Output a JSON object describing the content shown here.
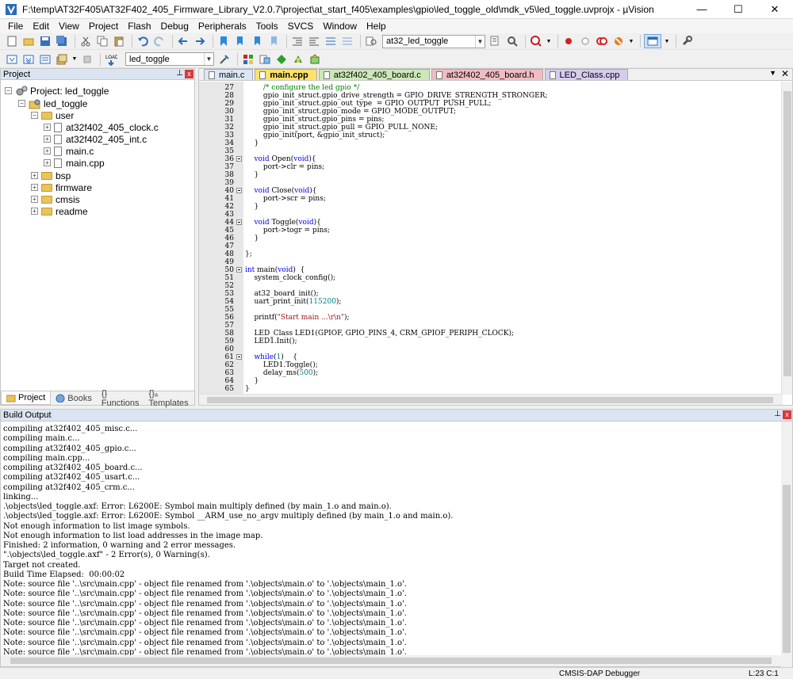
{
  "window": {
    "title": "F:\\temp\\AT32F405\\AT32F402_405_Firmware_Library_V2.0.7\\project\\at_start_f405\\examples\\gpio\\led_toggle_old\\mdk_v5\\led_toggle.uvprojx - µVision",
    "minimize": "—",
    "maximize": "☐",
    "close": "✕"
  },
  "menu": [
    "File",
    "Edit",
    "View",
    "Project",
    "Flash",
    "Debug",
    "Peripherals",
    "Tools",
    "SVCS",
    "Window",
    "Help"
  ],
  "toolbar1": {
    "target_combo": "at32_led_toggle"
  },
  "toolbar2": {
    "target_select": "led_toggle"
  },
  "project": {
    "header": "Project",
    "pin": "⊥",
    "close": "x",
    "root": "Project: led_toggle",
    "target": "led_toggle",
    "groups": {
      "user": "user",
      "bsp": "bsp",
      "firmware": "firmware",
      "cmsis": "cmsis",
      "readme": "readme"
    },
    "user_files": [
      "at32f402_405_clock.c",
      "at32f402_405_int.c",
      "main.c",
      "main.cpp"
    ],
    "tabs": [
      "Project",
      "Books",
      "{} Functions",
      "{}ₐ Templates"
    ]
  },
  "editor": {
    "tabs": [
      "main.c",
      "main.cpp",
      "at32f402_405_board.c",
      "at32f402_405_board.h",
      "LED_Class.cpp"
    ],
    "active_tab": "main.cpp",
    "tab_menu": "▼",
    "tab_close": "✕",
    "lines": [
      {
        "n": "27",
        "t": "        /* configure the led gpio */"
      },
      {
        "n": "28",
        "t": "        gpio_init_struct.gpio_drive_strength = GPIO_DRIVE_STRENGTH_STRONGER;"
      },
      {
        "n": "29",
        "t": "        gpio_init_struct.gpio_out_type  = GPIO_OUTPUT_PUSH_PULL;"
      },
      {
        "n": "30",
        "t": "        gpio_init_struct.gpio_mode = GPIO_MODE_OUTPUT;"
      },
      {
        "n": "31",
        "t": "        gpio_init_struct.gpio_pins = pins;"
      },
      {
        "n": "32",
        "t": "        gpio_init_struct.gpio_pull = GPIO_PULL_NONE;"
      },
      {
        "n": "33",
        "t": "        gpio_init(port, &gpio_init_struct);"
      },
      {
        "n": "34",
        "t": "    }"
      },
      {
        "n": "35",
        "t": ""
      },
      {
        "n": "36",
        "t": "    void Open(void){"
      },
      {
        "n": "37",
        "t": "        port->clr = pins;"
      },
      {
        "n": "38",
        "t": "    }"
      },
      {
        "n": "39",
        "t": ""
      },
      {
        "n": "40",
        "t": "    void Close(void){"
      },
      {
        "n": "41",
        "t": "        port->scr = pins;"
      },
      {
        "n": "42",
        "t": "    }"
      },
      {
        "n": "43",
        "t": ""
      },
      {
        "n": "44",
        "t": "    void Toggle(void){"
      },
      {
        "n": "45",
        "t": "        port->togr = pins;"
      },
      {
        "n": "46",
        "t": "    }"
      },
      {
        "n": "47",
        "t": ""
      },
      {
        "n": "48",
        "t": "};"
      },
      {
        "n": "49",
        "t": ""
      },
      {
        "n": "50",
        "t": "int main(void)  {"
      },
      {
        "n": "51",
        "t": "    system_clock_config();"
      },
      {
        "n": "52",
        "t": ""
      },
      {
        "n": "53",
        "t": "    at32_board_init();"
      },
      {
        "n": "54",
        "t": "    uart_print_init(115200);"
      },
      {
        "n": "55",
        "t": ""
      },
      {
        "n": "56",
        "t": "    printf(\"Start main ...\\r\\n\");"
      },
      {
        "n": "57",
        "t": ""
      },
      {
        "n": "58",
        "t": "    LED_Class LED1(GPIOF, GPIO_PINS_4, CRM_GPIOF_PERIPH_CLOCK);"
      },
      {
        "n": "59",
        "t": "    LED1.Init();"
      },
      {
        "n": "60",
        "t": ""
      },
      {
        "n": "61",
        "t": "    while(1)    {"
      },
      {
        "n": "62",
        "t": "        LED1.Toggle();"
      },
      {
        "n": "63",
        "t": "        delay_ms(500);"
      },
      {
        "n": "64",
        "t": "    }"
      },
      {
        "n": "65",
        "t": "}"
      }
    ]
  },
  "build": {
    "header": "Build Output",
    "lines": [
      "compiling at32f402_405_misc.c...",
      "compiling main.c...",
      "compiling at32f402_405_gpio.c...",
      "compiling main.cpp...",
      "compiling at32f402_405_board.c...",
      "compiling at32f402_405_usart.c...",
      "compiling at32f402_405_crm.c...",
      "linking...",
      ".\\objects\\led_toggle.axf: Error: L6200E: Symbol main multiply defined (by main_1.o and main.o).",
      ".\\objects\\led_toggle.axf: Error: L6200E: Symbol __ARM_use_no_argv multiply defined (by main_1.o and main.o).",
      "Not enough information to list image symbols.",
      "Not enough information to list load addresses in the image map.",
      "Finished: 2 information, 0 warning and 2 error messages.",
      "\".\\objects\\led_toggle.axf\" - 2 Error(s), 0 Warning(s).",
      "Target not created.",
      "Build Time Elapsed:  00:00:02",
      "Note: source file '..\\src\\main.cpp' - object file renamed from '.\\objects\\main.o' to '.\\objects\\main_1.o'.",
      "Note: source file '..\\src\\main.cpp' - object file renamed from '.\\objects\\main.o' to '.\\objects\\main_1.o'.",
      "Note: source file '..\\src\\main.cpp' - object file renamed from '.\\objects\\main.o' to '.\\objects\\main_1.o'.",
      "Note: source file '..\\src\\main.cpp' - object file renamed from '.\\objects\\main.o' to '.\\objects\\main_1.o'.",
      "Note: source file '..\\src\\main.cpp' - object file renamed from '.\\objects\\main.o' to '.\\objects\\main_1.o'.",
      "Note: source file '..\\src\\main.cpp' - object file renamed from '.\\objects\\main.o' to '.\\objects\\main_1.o'.",
      "Note: source file '..\\src\\main.cpp' - object file renamed from '.\\objects\\main.o' to '.\\objects\\main_1.o'.",
      "Note: source file '..\\src\\main.cpp' - object file renamed from '.\\objects\\main.o' to '.\\objects\\main_1.o'."
    ]
  },
  "status": {
    "debugger": "CMSIS-DAP Debugger",
    "position": "L:23 C:1"
  },
  "colors": {
    "comment": "#008000",
    "keyword": "#0000ff",
    "number": "#008080",
    "string": "#a31515",
    "active_tab": "#ffe26a"
  }
}
